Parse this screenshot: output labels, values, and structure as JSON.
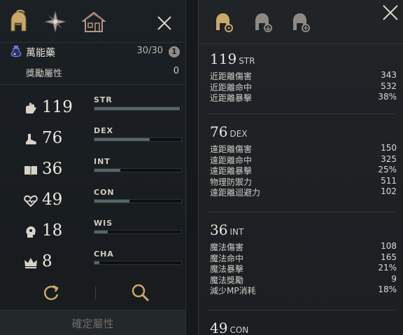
{
  "left_panel": {
    "potion": {
      "name": "萬能藥",
      "count": "30/30",
      "info": "1"
    },
    "bonus": {
      "label": "獎勵屬性",
      "value": "0"
    },
    "stats": [
      {
        "name": "STR",
        "value": "119",
        "icon": "fist-icon",
        "fill": 0.98
      },
      {
        "name": "DEX",
        "value": "76",
        "icon": "boot-icon",
        "fill": 0.64
      },
      {
        "name": "INT",
        "value": "36",
        "icon": "book-icon",
        "fill": 0.3
      },
      {
        "name": "CON",
        "value": "49",
        "icon": "heart-icon",
        "fill": 0.4
      },
      {
        "name": "WIS",
        "value": "18",
        "icon": "head-icon",
        "fill": 0.15
      },
      {
        "name": "CHA",
        "value": "8",
        "icon": "crown-icon",
        "fill": 0.06
      }
    ],
    "confirm_label": "確定屬性"
  },
  "right_panel": {
    "sections": [
      {
        "value": "119",
        "abbr": "STR",
        "rows": [
          {
            "label": "近距離傷害",
            "value": "343"
          },
          {
            "label": "近距離命中",
            "value": "532"
          },
          {
            "label": "近距離暴擊",
            "value": "38%"
          }
        ]
      },
      {
        "value": "76",
        "abbr": "DEX",
        "rows": [
          {
            "label": "遠距離傷害",
            "value": "150"
          },
          {
            "label": "遠距離命中",
            "value": "325"
          },
          {
            "label": "遠距離暴擊",
            "value": "25%"
          },
          {
            "label": "物理防禦力",
            "value": "511"
          },
          {
            "label": "遠距離迴避力",
            "value": "102"
          }
        ]
      },
      {
        "value": "36",
        "abbr": "INT",
        "rows": [
          {
            "label": "魔法傷害",
            "value": "108"
          },
          {
            "label": "魔法命中",
            "value": "165"
          },
          {
            "label": "魔法暴擊",
            "value": "21%"
          },
          {
            "label": "魔法獎勵",
            "value": "9"
          },
          {
            "label": "減少MP消耗",
            "value": "18%"
          }
        ]
      },
      {
        "value": "49",
        "abbr": "CON",
        "rows": []
      }
    ]
  },
  "colors": {
    "accent": "#c9a86a",
    "panel": "#1b2024",
    "bar_fill": "#55666a"
  }
}
